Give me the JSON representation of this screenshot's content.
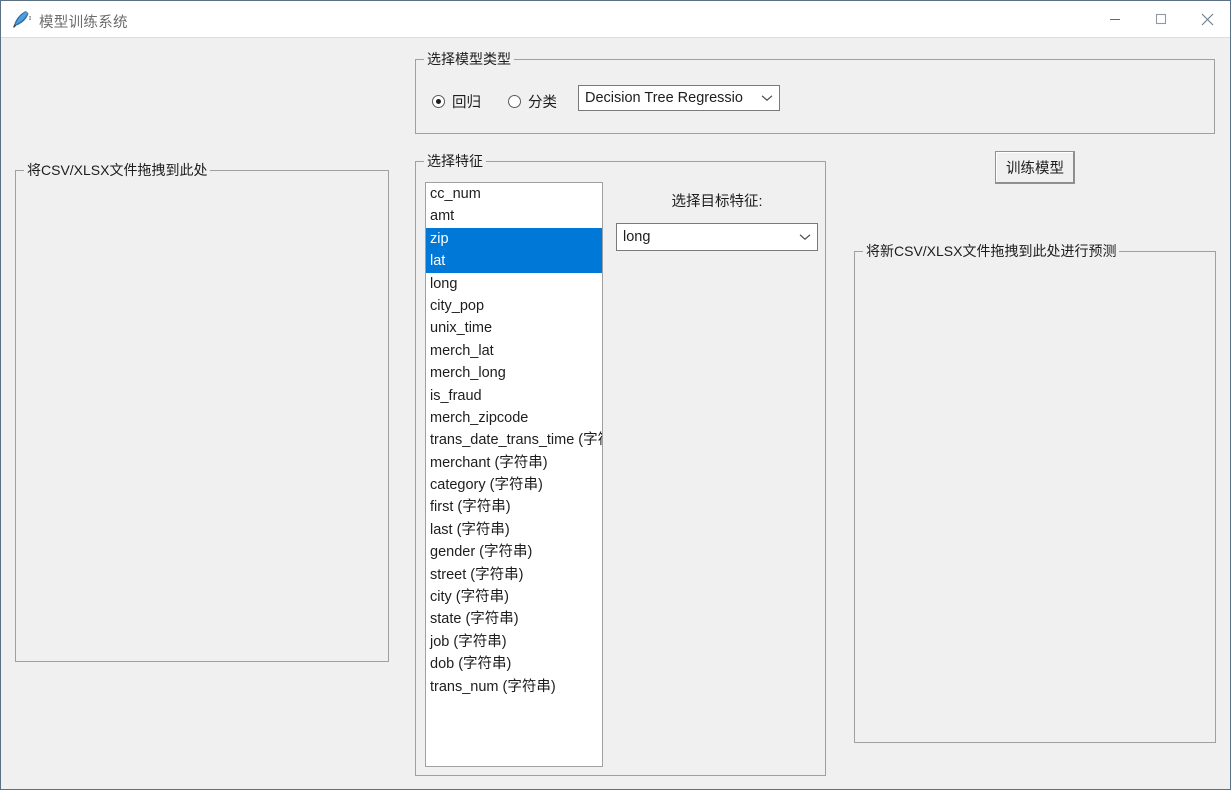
{
  "window": {
    "title": "模型训练系统",
    "icon": "feather-icon",
    "controls": {
      "minimize": "minimize-icon",
      "maximize": "maximize-icon",
      "close": "close-icon"
    },
    "colors": {
      "background": "#f0f0f0",
      "titlebar": "#ffffff",
      "selection": "#0078d7",
      "border": "#a0a0a0",
      "window_border": "#5b7083"
    }
  },
  "model_type_group": {
    "label": "选择模型类型",
    "radio_regression": {
      "label": "回归",
      "checked": true
    },
    "radio_classification": {
      "label": "分类",
      "checked": false
    },
    "model_combo": {
      "value": "Decision Tree Regressio",
      "arrow": "chevron-down-icon"
    }
  },
  "train_dropzone": {
    "label": "将CSV/XLSX文件拖拽到此处",
    "content": ""
  },
  "features_group": {
    "label": "选择特征",
    "listbox_items": [
      {
        "label": "cc_num",
        "selected": false
      },
      {
        "label": "amt",
        "selected": false
      },
      {
        "label": "zip",
        "selected": true
      },
      {
        "label": "lat",
        "selected": true
      },
      {
        "label": "long",
        "selected": false
      },
      {
        "label": "city_pop",
        "selected": false
      },
      {
        "label": "unix_time",
        "selected": false
      },
      {
        "label": "merch_lat",
        "selected": false
      },
      {
        "label": "merch_long",
        "selected": false
      },
      {
        "label": "is_fraud",
        "selected": false
      },
      {
        "label": "merch_zipcode",
        "selected": false
      },
      {
        "label": "trans_date_trans_time (字符串)",
        "selected": false
      },
      {
        "label": "merchant (字符串)",
        "selected": false
      },
      {
        "label": "category (字符串)",
        "selected": false
      },
      {
        "label": "first (字符串)",
        "selected": false
      },
      {
        "label": "last (字符串)",
        "selected": false
      },
      {
        "label": "gender (字符串)",
        "selected": false
      },
      {
        "label": "street (字符串)",
        "selected": false
      },
      {
        "label": "city (字符串)",
        "selected": false
      },
      {
        "label": "state (字符串)",
        "selected": false
      },
      {
        "label": "job (字符串)",
        "selected": false
      },
      {
        "label": "dob (字符串)",
        "selected": false
      },
      {
        "label": "trans_num (字符串)",
        "selected": false
      }
    ],
    "target_label": "选择目标特征:",
    "target_combo": {
      "value": "long",
      "arrow": "chevron-down-icon"
    }
  },
  "train_button": {
    "label": "训练模型"
  },
  "predict_dropzone": {
    "label": "将新CSV/XLSX文件拖拽到此处进行预测",
    "content": ""
  }
}
